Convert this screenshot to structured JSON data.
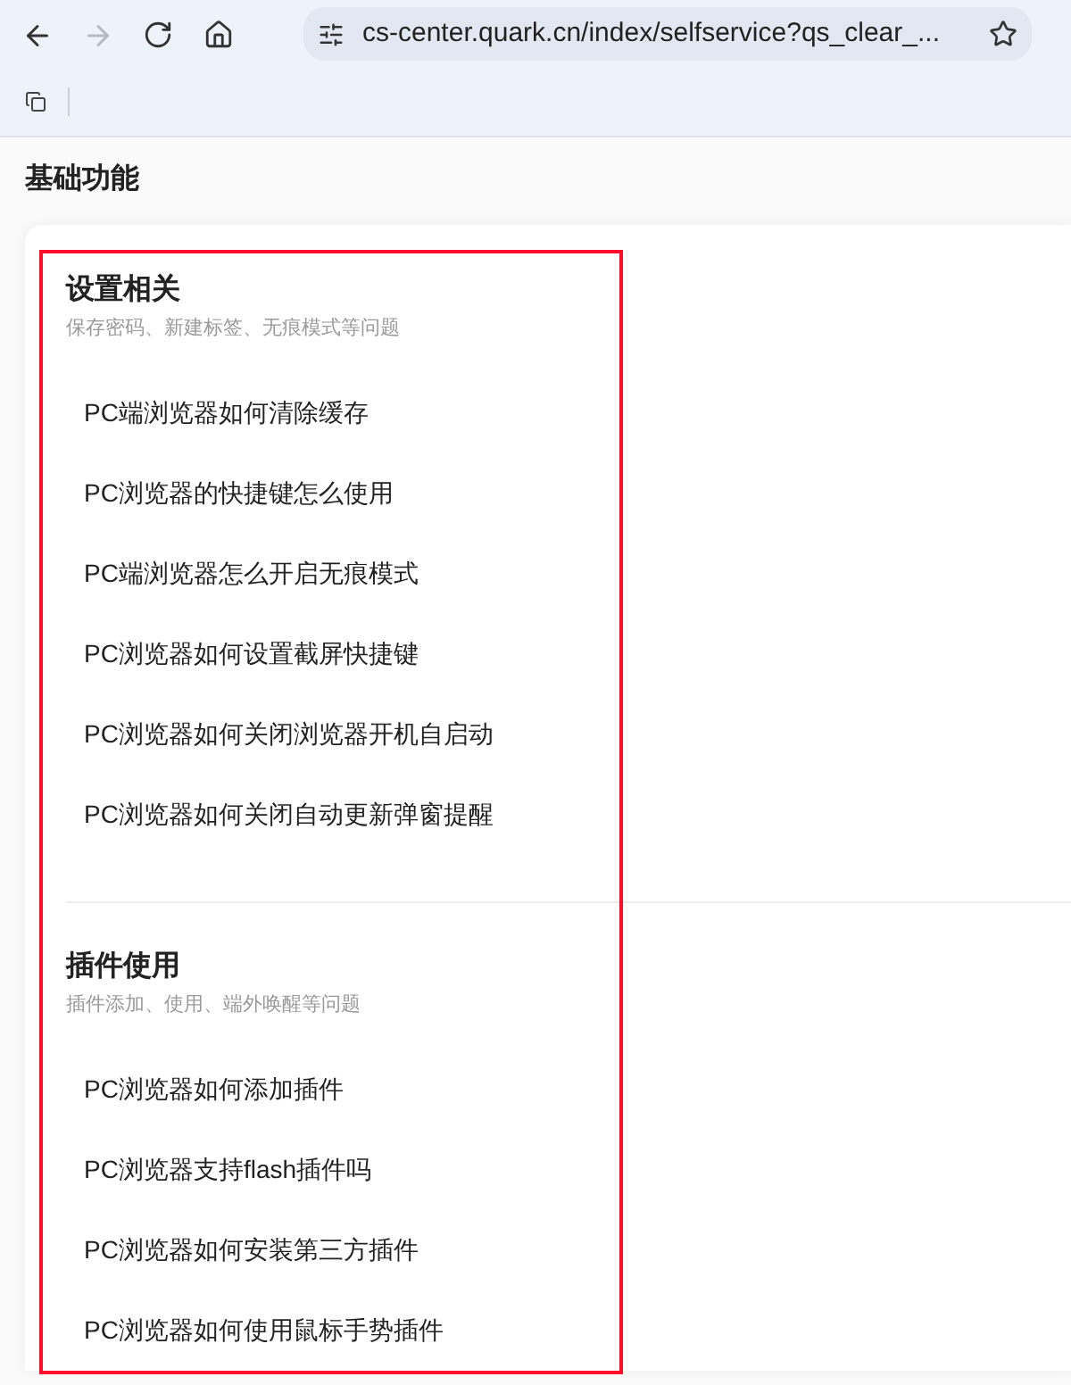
{
  "browser": {
    "url": "cs-center.quark.cn/index/selfservice?qs_clear_...",
    "forward_disabled": true
  },
  "page_title": "基础功能",
  "sections": [
    {
      "title": "设置相关",
      "subtitle": "保存密码、新建标签、无痕模式等问题",
      "items": [
        "PC端浏览器如何清除缓存",
        "PC浏览器的快捷键怎么使用",
        "PC端浏览器怎么开启无痕模式",
        "PC浏览器如何设置截屏快捷键",
        "PC浏览器如何关闭浏览器开机自启动",
        "PC浏览器如何关闭自动更新弹窗提醒"
      ]
    },
    {
      "title": "插件使用",
      "subtitle": "插件添加、使用、端外唤醒等问题",
      "items": [
        "PC浏览器如何添加插件",
        "PC浏览器支持flash插件吗",
        "PC浏览器如何安装第三方插件",
        "PC浏览器如何使用鼠标手势插件"
      ]
    }
  ]
}
